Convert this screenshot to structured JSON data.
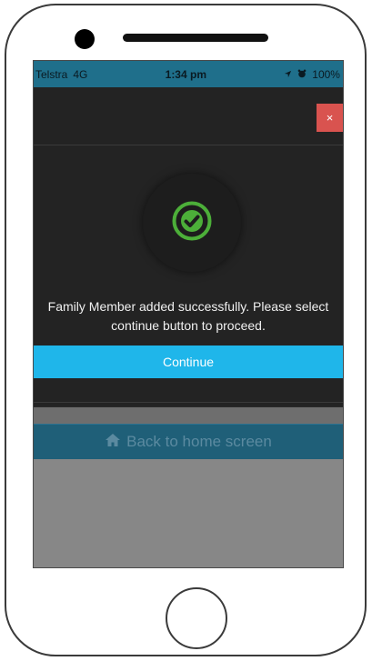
{
  "status_bar": {
    "carrier": "Telstra",
    "network": "4G",
    "time": "1:34 pm",
    "battery": "100%",
    "icons": [
      "location-arrow-icon",
      "alarm-clock-icon"
    ]
  },
  "modal": {
    "close_label": "×",
    "success_icon": "check-circle-icon",
    "message": "Family Member added successfully. Please select continue button to proceed.",
    "continue_label": "Continue"
  },
  "footer": {
    "home_icon": "home-icon",
    "back_home_label": "Back to home screen"
  },
  "colors": {
    "accent": "#1fb6ea",
    "success": "#4caf39",
    "close": "#d9534f",
    "status_bar": "#1f6f8b"
  }
}
